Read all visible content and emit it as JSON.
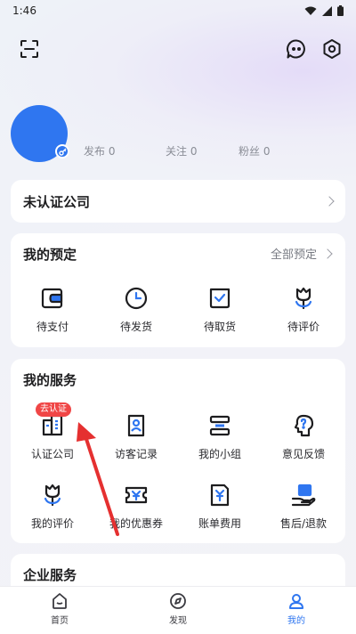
{
  "status_bar": {
    "time": "1:46"
  },
  "stats": {
    "posts": "发布 0",
    "following": "关注 0",
    "fans": "粉丝 0"
  },
  "company": {
    "label": "未认证公司"
  },
  "reservations": {
    "title": "我的预定",
    "more": "全部预定",
    "items": [
      {
        "label": "待支付",
        "icon": "wallet-icon"
      },
      {
        "label": "待发货",
        "icon": "clock-icon"
      },
      {
        "label": "待取货",
        "icon": "check-box-icon"
      },
      {
        "label": "待评价",
        "icon": "flower-icon"
      }
    ]
  },
  "services": {
    "title": "我的服务",
    "badge": "去认证",
    "items": [
      {
        "label": "认证公司",
        "icon": "building-icon"
      },
      {
        "label": "访客记录",
        "icon": "visitor-record-icon"
      },
      {
        "label": "我的小组",
        "icon": "group-icon"
      },
      {
        "label": "意见反馈",
        "icon": "feedback-icon"
      },
      {
        "label": "我的评价",
        "icon": "review-icon"
      },
      {
        "label": "我的优惠券",
        "icon": "coupon-icon"
      },
      {
        "label": "账单费用",
        "icon": "bill-icon"
      },
      {
        "label": "售后/退款",
        "icon": "refund-icon"
      }
    ]
  },
  "enterprise": {
    "title": "企业服务"
  },
  "tabbar": {
    "items": [
      {
        "label": "首页",
        "icon": "home-icon"
      },
      {
        "label": "发现",
        "icon": "compass-icon"
      },
      {
        "label": "我的",
        "icon": "profile-icon"
      }
    ],
    "active_color": "#2f76f0"
  },
  "colors": {
    "accent": "#2f76f0",
    "badge": "#f04646",
    "annotation_arrow": "#e53030"
  }
}
